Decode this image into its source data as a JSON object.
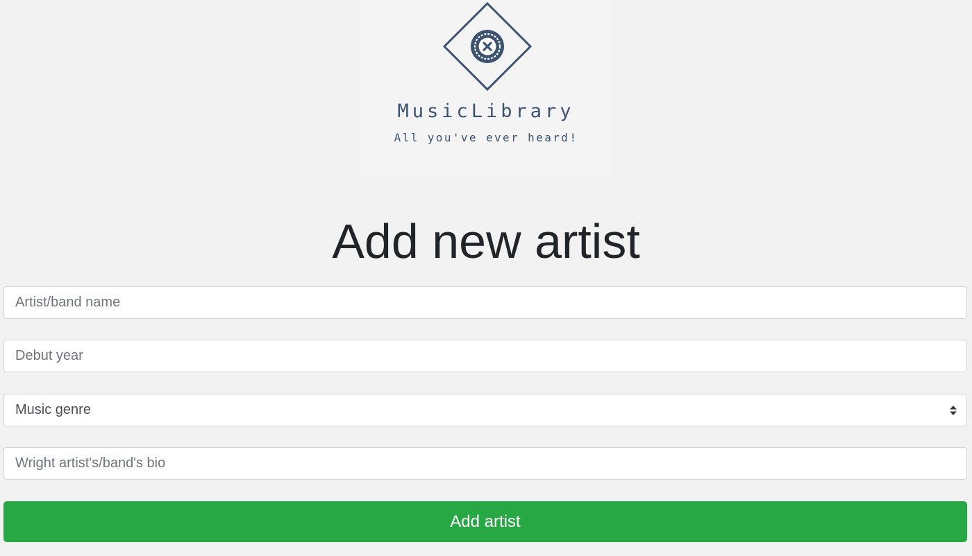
{
  "brand": {
    "name": "MusicLibrary",
    "tagline": "All you've ever heard!",
    "logo_icon": "vinyl-record-diamond-icon",
    "color": "#3b5271"
  },
  "page": {
    "title": "Add new artist"
  },
  "form": {
    "name_placeholder": "Artist/band name",
    "year_placeholder": "Debut year",
    "genre_selected": "Music genre",
    "bio_placeholder": "Wright artist's/band's bio",
    "submit_label": "Add artist",
    "submit_color": "#28a745"
  }
}
